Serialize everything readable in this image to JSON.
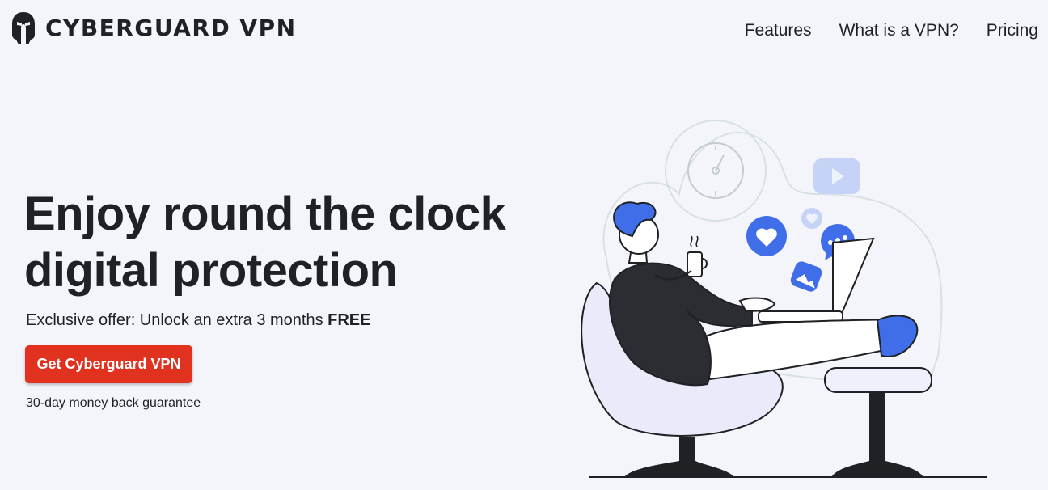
{
  "colors": {
    "bg": "#f3f5fa",
    "cta": "#e0321f",
    "accent": "#3f6ee8",
    "text": "#1f2124"
  },
  "header": {
    "logo_text": "CYBERGUARD VPN",
    "logo_icon": "spartan-helmet-icon",
    "nav": [
      {
        "label": "Features"
      },
      {
        "label": "What is a VPN?"
      },
      {
        "label": "Pricing"
      }
    ]
  },
  "hero": {
    "title_line1": "Enjoy round the clock",
    "title_line2": "digital protection",
    "offer_text": "Exclusive offer: Unlock an extra 3 months ",
    "offer_bold": "FREE",
    "cta_label": "Get Cyberguard VPN",
    "guarantee": "30-day money back guarantee"
  },
  "illustration": {
    "icons": [
      "clock-icon",
      "video-icon",
      "heart-icon",
      "chat-bubble-icon",
      "image-icon",
      "small-heart-icon",
      "laptop-icon",
      "coffee-cup-icon"
    ]
  }
}
